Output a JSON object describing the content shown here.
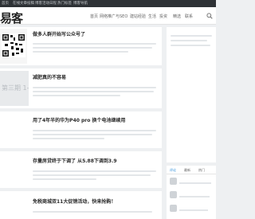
{
  "topbar": {
    "links": [
      "首页",
      "在线文章投稿",
      "博客活动日程",
      "热门标签",
      "博客导航"
    ]
  },
  "header": {
    "logo_text": "易客",
    "nav": [
      "首页",
      "网络推广与SEO",
      "建站经验",
      "生活",
      "投资",
      "精选",
      "联系"
    ]
  },
  "posts": [
    {
      "title": "做多人群开始写公众号了",
      "meta": "",
      "thumb_caption": ""
    },
    {
      "title": "减肥真的不容易",
      "meta": "",
      "thumb_caption": "第三期 1-10"
    },
    {
      "title": "用了4年半的华为P40 pro 换个电池继续用",
      "meta": ""
    },
    {
      "title": "存量房贷终于下调了 从5.88下调到3.9",
      "meta": ""
    },
    {
      "title": "免税商城双11大促销活动，快来抢购！",
      "meta": ""
    }
  ],
  "sidebar": {
    "tabs": [
      "评论",
      "最新",
      "热门"
    ],
    "comment_users": [
      "",
      "",
      ""
    ]
  }
}
